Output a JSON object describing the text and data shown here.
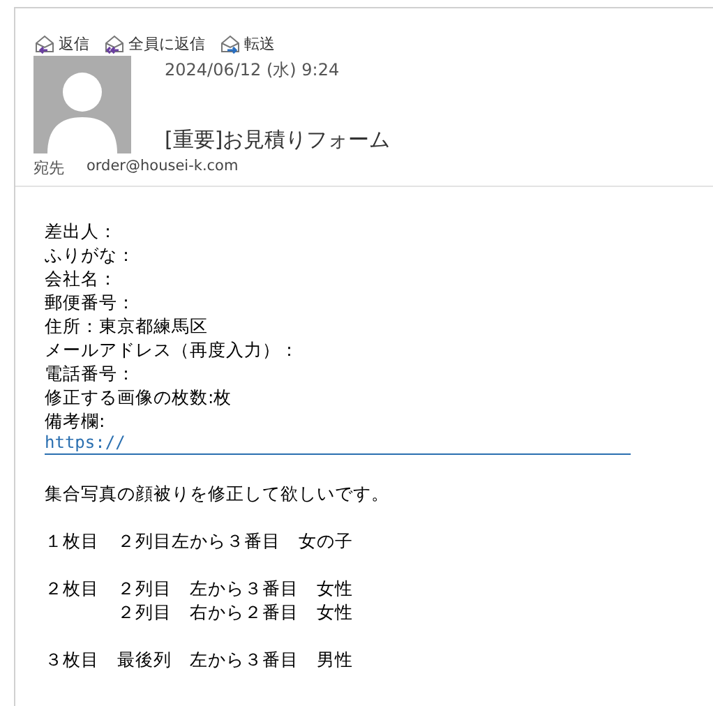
{
  "actions": [
    {
      "kind": "reply",
      "label": "返信"
    },
    {
      "kind": "reply-all",
      "label": "全員に返信"
    },
    {
      "kind": "forward",
      "label": "転送"
    }
  ],
  "message": {
    "date": "2024/06/12 (水) 9:24",
    "subject": "[重要]お見積りフォーム",
    "to_label": "宛先",
    "to": "order@housei-k.com"
  },
  "body": [
    {
      "kind": "text",
      "text": "差出人："
    },
    {
      "kind": "text",
      "text": "ふりがな："
    },
    {
      "kind": "text",
      "text": "会社名："
    },
    {
      "kind": "text",
      "text": "郵便番号："
    },
    {
      "kind": "text",
      "text": "住所：東京都練馬区"
    },
    {
      "kind": "text",
      "text": "メールアドレス（再度入力）："
    },
    {
      "kind": "text",
      "text": "電話番号："
    },
    {
      "kind": "text",
      "text": "修正する画像の枚数:枚"
    },
    {
      "kind": "text",
      "text": "備考欄:"
    },
    {
      "kind": "link",
      "text": "https://"
    },
    {
      "kind": "blank"
    },
    {
      "kind": "text",
      "text": "集合写真の顔被りを修正して欲しいです。"
    },
    {
      "kind": "blank"
    },
    {
      "kind": "text",
      "text": "１枚目　２列目左から３番目　女の子"
    },
    {
      "kind": "blank"
    },
    {
      "kind": "text",
      "text": "２枚目　２列目　左から３番目　女性"
    },
    {
      "kind": "text",
      "text": "　　　　２列目　右から２番目　女性"
    },
    {
      "kind": "blank"
    },
    {
      "kind": "text",
      "text": "３枚目　最後列　左から３番目　男性"
    }
  ]
}
